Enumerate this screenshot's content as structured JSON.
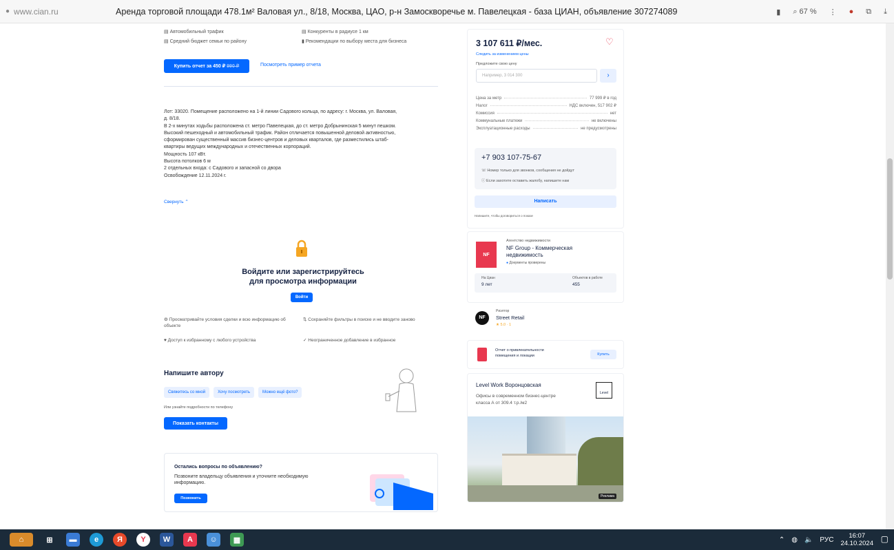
{
  "browser": {
    "url": "www.cian.ru",
    "title": "Аренда торговой площади 478.1м² Валовая ул., 8/18, Москва, ЦАО, р-н Замоскворечье м. Павелецкая - база ЦИАН, объявление 307274089",
    "zoom": "67 %"
  },
  "report": {
    "features": [
      "Автомобильный трафик",
      "Конкуренты в радиусе 1 км",
      "Средний бюджет семьи по району",
      "Рекомендации по выбору места для бизнеса"
    ],
    "buy_label": "Купить отчет за 450 ₽",
    "buy_old": "990 ₽",
    "example_link": "Посмотреть пример отчета"
  },
  "description": {
    "lines": [
      "Лот: 33020. Помещение расположено на 1-й линии Садового кольца, по адресу: г. Москва, ул. Валовая,",
      "д. 8/18.",
      "В 2-х минутах ходьбы расположена ст. метро Павелецкая, до ст. метро Добрынинская 5 минут пешком.",
      "Высокий пешеходный и автомобильный трафик. Район отличается повышенной деловой активностью,",
      "сформирован существенный массив бизнес-центров и деловых кварталов, где разместились штаб-",
      "квартиры ведущих международных и отечественных корпораций.",
      "Мощность 107 кВт.",
      "Высота потолков 6 м",
      "2 отдельных входа: с Садового и запасной со двора",
      "Освобождение 12.11.2024 г."
    ],
    "collapse": "Свернуть"
  },
  "login": {
    "title_line1": "Войдите или зарегистрируйтесь",
    "title_line2": "для просмотра информации",
    "button": "Войти",
    "benefits": [
      "Просматривайте условия сделки и всю информацию об объекте",
      "Сохраняйте фильтры в поиске и не вводите заново",
      "Доступ к избранному с любого устройства",
      "Неограниченное добавление в избранное"
    ]
  },
  "author": {
    "title": "Напишите автору",
    "chips": [
      "Свяжитесь со мной",
      "Хочу посмотреть",
      "Можно ещё фото?"
    ],
    "hint": "Или узнайте подробности по телефону",
    "button": "Показать контакты"
  },
  "questions": {
    "title": "Остались вопросы по объявлению?",
    "text_line1": "Позвоните владельцу объявления и уточните необходимую",
    "text_line2": "информацию.",
    "button": "Позвонить"
  },
  "price": {
    "value": "3 107 611 ₽/мес.",
    "watch": "Следить за изменением цены",
    "offer_label": "Предложите свою цену",
    "offer_placeholder": "Например, 3 014 300",
    "rows": [
      {
        "k": "Цена за метр",
        "v": "77 999 ₽ в год"
      },
      {
        "k": "Налог",
        "v": "НДС включен, 517 902 ₽"
      },
      {
        "k": "Комиссия",
        "v": "нет"
      },
      {
        "k": "Коммунальные платежи",
        "v": "не включены"
      },
      {
        "k": "Эксплуатационные расходы",
        "v": "не предусмотрены"
      }
    ]
  },
  "contact": {
    "phone": "+7 903 107-75-67",
    "note1": "Номер только для звонков, сообщения не дойдут",
    "note2": "Если захотите оставить жалобу, напишите нам",
    "write": "Написать",
    "small": "Напишите, чтобы договориться о показе"
  },
  "agency": {
    "label": "Агентство недвижимости",
    "name_line1": "NF Group - Коммерческая",
    "name_line2": "недвижимость",
    "verified": "Документы проверены",
    "stat1_k": "На Циан",
    "stat1_v": "9 лет",
    "stat2_k": "Объектов в работе",
    "stat2_v": "455",
    "logo_text": "NF"
  },
  "realtor": {
    "label": "Риэлтор",
    "name": "Street Retail",
    "rating": "★ 5.0 · 1"
  },
  "report_card": {
    "text_line1": "Отчет о привлекательности",
    "text_line2": "помещения и локации",
    "button": "Купить"
  },
  "ad": {
    "title": "Level Work Воронцовская",
    "text_line1": "Офисы в современном бизнес-центре",
    "text_line2": "класса А от 309.4 т.р./м2",
    "logo": "Level",
    "badge": "Реклама"
  },
  "tray": {
    "lang": "РУС",
    "time": "16:07",
    "date": "24.10.2024"
  },
  "colors": {
    "accent": "#0468ff",
    "text": "#152242",
    "taskbar": "#1b2b3a"
  }
}
